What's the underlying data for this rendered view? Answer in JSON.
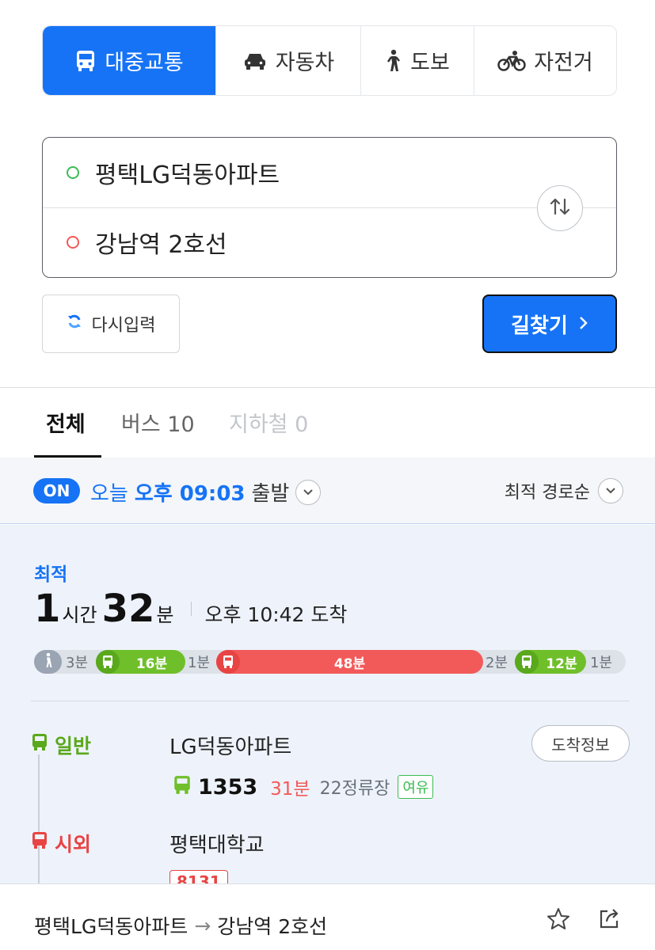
{
  "modes": {
    "transit": "대중교통",
    "car": "자동차",
    "walk": "도보",
    "bike": "자전거",
    "active": "transit",
    "accent": "#1673f5"
  },
  "route": {
    "origin": "평택LG덕동아파트",
    "destination": "강남역 2호선",
    "swap_icon": "swap-vertical-icon"
  },
  "actions": {
    "reset": "다시입력",
    "search": "길찾기"
  },
  "result_tabs": {
    "all": "전체",
    "bus": "버스 10",
    "subway": "지하철 0"
  },
  "time": {
    "on_badge": "ON",
    "prefix": "오늘",
    "time": "오후 09:03",
    "suffix": "출발",
    "sort": "최적 경로순"
  },
  "best": {
    "tag": "최적",
    "hours": "1",
    "hour_unit": "시간",
    "minutes": "32",
    "minute_unit": "분",
    "arrival": "오후 10:42 도착",
    "timeline": {
      "walk1": "3분",
      "bus1": "16분",
      "walk2": "1분",
      "bus2": "48분",
      "walk3": "2분",
      "bus3": "12분",
      "walk4": "1분",
      "colors": {
        "green": "#6fbf2a",
        "red": "#f25a5a",
        "walk": "#9aa4b2"
      }
    },
    "legs": [
      {
        "type": "일반",
        "stop": "LG덕동아파트",
        "arrival_info": "도착정보",
        "bus_no": "1353",
        "mins": "31분",
        "stops": "22정류장",
        "crowd": "여유"
      },
      {
        "type": "시외",
        "stop": "평택대학교",
        "bus_no": "8131"
      }
    ]
  },
  "bottom": {
    "from": "평택LG덕동아파트",
    "arrow": "→",
    "to": "강남역 2호선"
  }
}
